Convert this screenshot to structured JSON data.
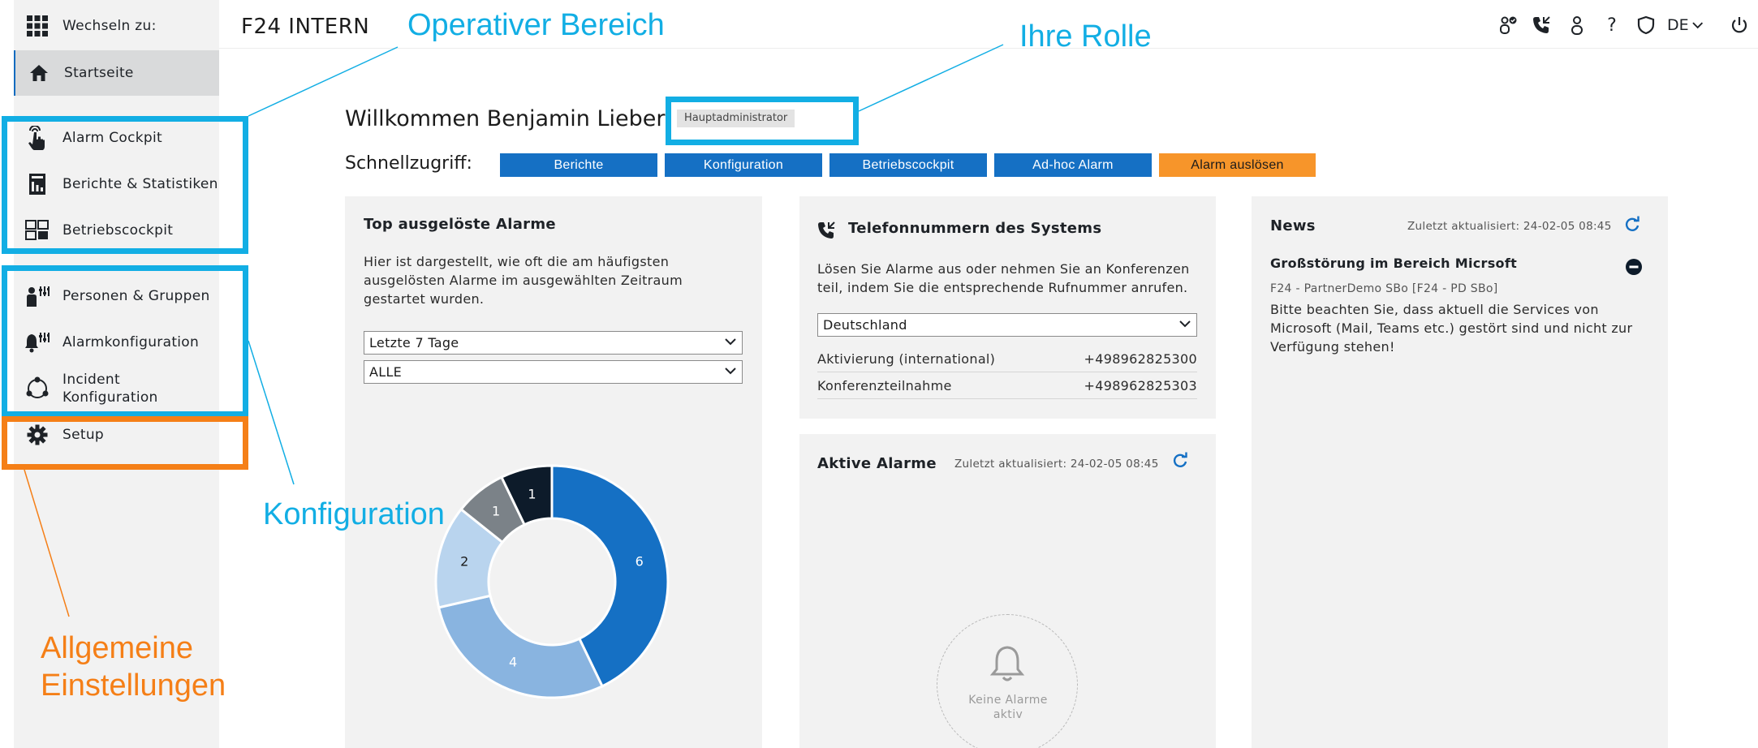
{
  "header": {
    "app_title": "F24 INTERN",
    "language": "DE",
    "icons": [
      "user-status-icon",
      "phone-icon",
      "user-icon",
      "help-icon",
      "shield-icon",
      "language-selector",
      "power-icon"
    ]
  },
  "sidebar": {
    "switch_label": "Wechseln zu:",
    "home_label": "Startseite",
    "items": [
      {
        "label": "Alarm Cockpit",
        "icon": "hand-pointer-icon"
      },
      {
        "label": "Berichte & Statistiken",
        "icon": "report-icon"
      },
      {
        "label": "Betriebscockpit",
        "icon": "dashboard-icon"
      },
      {
        "label": "Personen & Gruppen",
        "icon": "person-settings-icon"
      },
      {
        "label": "Alarmkonfiguration",
        "icon": "bell-settings-icon"
      },
      {
        "label": "Incident Konfiguration",
        "icon": "cycle-icon"
      },
      {
        "label": "Setup",
        "icon": "gear-icon"
      }
    ]
  },
  "welcome": {
    "text": "Willkommen Benjamin Lieber!",
    "role": "Hauptadministrator"
  },
  "quick_access": {
    "label": "Schnellzugriff:",
    "buttons": [
      "Berichte",
      "Konfiguration",
      "Betriebscockpit",
      "Ad-hoc Alarm",
      "Alarm auslösen"
    ]
  },
  "top_alarms": {
    "title": "Top ausgelöste Alarme",
    "description": "Hier ist dargestellt, wie oft die am häufigsten ausgelösten Alarme im ausgewählten Zeitraum gestartet wurden.",
    "range_select": "Letzte 7 Tage",
    "filter_select": "ALLE"
  },
  "chart_data": {
    "type": "pie",
    "values": [
      6,
      4,
      2,
      1,
      1
    ],
    "colors": [
      "#1570c4",
      "#89b4e0",
      "#b9d4ee",
      "#7b8288",
      "#0d1b2a"
    ]
  },
  "phones": {
    "title": "Telefonnummern des Systems",
    "description": "Lösen Sie Alarme aus oder nehmen Sie an Konferenzen teil, indem Sie die entsprechende Rufnummer anrufen.",
    "country_select": "Deutschland",
    "rows": [
      {
        "label": "Aktivierung (international)",
        "number": "+498962825300"
      },
      {
        "label": "Konferenzteilnahme",
        "number": "+498962825303"
      }
    ]
  },
  "active_alarms": {
    "title": "Aktive Alarme",
    "updated": "Zuletzt aktualisiert: 24-02-05 08:45",
    "empty_text": "Keine Alarme aktiv"
  },
  "news": {
    "title": "News",
    "updated": "Zuletzt aktualisiert: 24-02-05 08:45",
    "item_title": "Großstörung im Bereich Micrsoft",
    "item_source": "F24 - PartnerDemo SBo [F24 - PD SBo]",
    "item_text": "Bitte beachten Sie, dass aktuell die Services von Microsoft (Mail, Teams etc.) gestört sind und nicht zur Verfügung stehen!"
  },
  "annotations": {
    "operativ": "Operativer Bereich",
    "rolle": "Ihre Rolle",
    "konfiguration": "Konfiguration",
    "allgemein_line1": "Allgemeine",
    "allgemein_line2": "Einstellungen",
    "colors": {
      "blue": "#12aee4",
      "orange": "#f57f17"
    }
  },
  "colors": {
    "primary": "#1570c4",
    "alarm": "#f7952a",
    "panel": "#f2f2f2"
  }
}
